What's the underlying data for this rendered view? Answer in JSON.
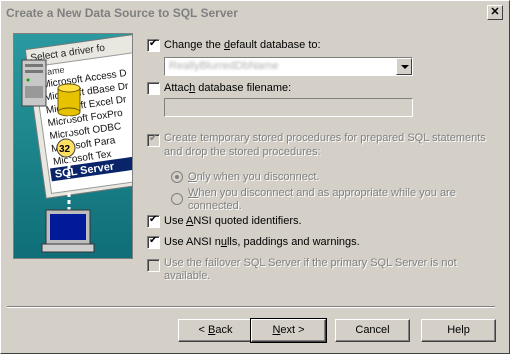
{
  "window": {
    "title": "Create a New Data Source to SQL Server"
  },
  "art": {
    "list_header": "Select a driver fo",
    "column_label": "Name",
    "drivers": [
      "Microsoft Access D",
      "Microsoft dBase Dr",
      "Microsoft Excel Dr",
      "Microsoft FoxPro",
      "Microsoft ODBC",
      "Microsoft Para",
      "Microsoft Tex",
      "SQL Server"
    ],
    "badge": "32"
  },
  "options": {
    "change_db": {
      "pre": "Change the ",
      "accel": "d",
      "post": "efault database to:",
      "checked": true
    },
    "database_value": "ReallyBlurredDbName",
    "attach": {
      "pre": "Attac",
      "accel": "h",
      "post": " database filename:",
      "checked": false
    },
    "temp_procs": {
      "line1": "Create temporary stored procedures for prepared SQL statements",
      "line2": "and drop the stored procedures:",
      "checked": true
    },
    "radio_only": {
      "accel": "O",
      "post": "nly when you disconnect."
    },
    "radio_when": {
      "accel": "W",
      "post": "hen you disconnect and as appropriate while you are",
      "line2": "connected."
    },
    "ansi_quoted": {
      "pre": "Use ",
      "accel": "A",
      "post": "NSI quoted identifiers.",
      "checked": true
    },
    "ansi_nulls": {
      "pre": "Use ANSI n",
      "accel": "u",
      "post": "lls, paddings and warnings.",
      "checked": true
    },
    "failover": {
      "line1": "Use the failover SQL Server if the primary SQL Server is not",
      "line2": "available.",
      "checked": false
    }
  },
  "buttons": {
    "back": {
      "pre": "< ",
      "accel": "B",
      "post": "ack"
    },
    "next": {
      "accel": "N",
      "post": "ext >"
    },
    "cancel": "Cancel",
    "help": "Help"
  }
}
